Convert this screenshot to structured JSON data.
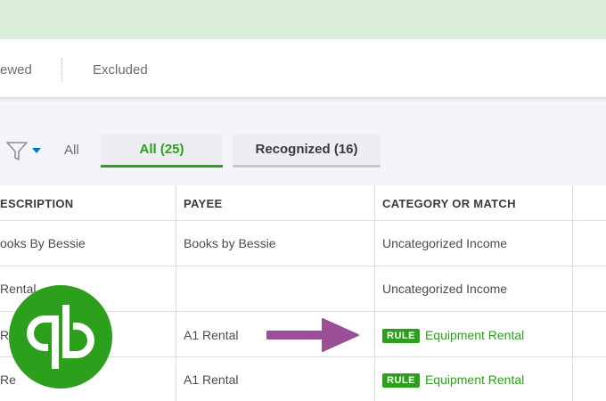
{
  "tabs": [
    "ewed",
    "Excluded"
  ],
  "filter": {
    "all_label": "All",
    "pill_all": "All (25)",
    "pill_recognized": "Recognized (16)"
  },
  "table": {
    "headers": [
      "ESCRIPTION",
      "PAYEE",
      "CATEGORY OR MATCH"
    ],
    "rows": [
      {
        "description": "ooks By Bessie",
        "payee": "Books by Bessie",
        "category": "Uncategorized Income",
        "rule": ""
      },
      {
        "description": "Rental",
        "payee": "",
        "category": "Uncategorized Income",
        "rule": ""
      },
      {
        "description": "Re",
        "payee": "A1 Rental",
        "category": "Equipment Rental",
        "rule": "RULE"
      },
      {
        "description": "Re",
        "payee": "A1 Rental",
        "category": "Equipment Rental",
        "rule": "RULE"
      }
    ]
  },
  "colors": {
    "brand_green": "#2ca01c",
    "arrow": "#9b4f96",
    "banner": "#dbeed9"
  },
  "icons": [
    "filter-icon",
    "chevron-down-icon",
    "arrow-right-icon",
    "quickbooks-logo"
  ]
}
